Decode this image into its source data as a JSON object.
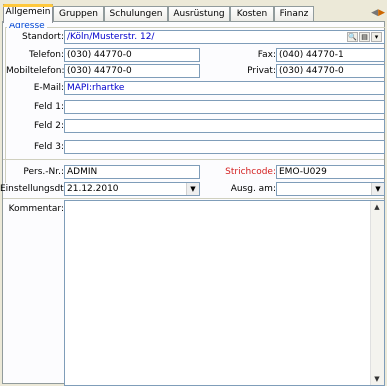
{
  "tabs": [
    {
      "label": "Allgemein",
      "active": true
    },
    {
      "label": "Gruppen",
      "active": false
    },
    {
      "label": "Schulungen",
      "active": false
    },
    {
      "label": "Ausrüstung",
      "active": false
    },
    {
      "label": "Kosten",
      "active": false
    },
    {
      "label": "Finanz",
      "active": false
    }
  ],
  "address": {
    "legend": "Adresse",
    "standort_label": "Standort:",
    "standort_value": "/Köln/Musterstr. 12/",
    "telefon_label": "Telefon:",
    "telefon_value": "(030) 44770-0",
    "fax_label": "Fax:",
    "fax_value": "(040) 44770-1",
    "mobil_label": "Mobiltelefon:",
    "mobil_value": "(030) 44770-0",
    "privat_label": "Privat:",
    "privat_value": "(030) 44770-0",
    "email_label": "E-Mail:",
    "email_value": "MAPI:rhartke",
    "feld1_label": "Feld 1:",
    "feld1_value": "",
    "feld2_label": "Feld 2:",
    "feld2_value": "",
    "feld3_label": "Feld 3:",
    "feld3_value": ""
  },
  "person": {
    "persnr_label": "Pers.-Nr.:",
    "persnr_value": "ADMIN",
    "strichcode_label": "Strichcode:",
    "strichcode_value": "EMO-U029",
    "einstellung_label": "Einstellungsdt.:",
    "einstellung_value": "21.12.2010",
    "ausg_label": "Ausg. am:",
    "ausg_value": "",
    "kommentar_label": "Kommentar:",
    "kommentar_value": ""
  },
  "colors": {
    "accent": "#0046d5",
    "link": "#0000cc",
    "required": "#d42020",
    "active_tab_highlight": "#ffc83c"
  }
}
